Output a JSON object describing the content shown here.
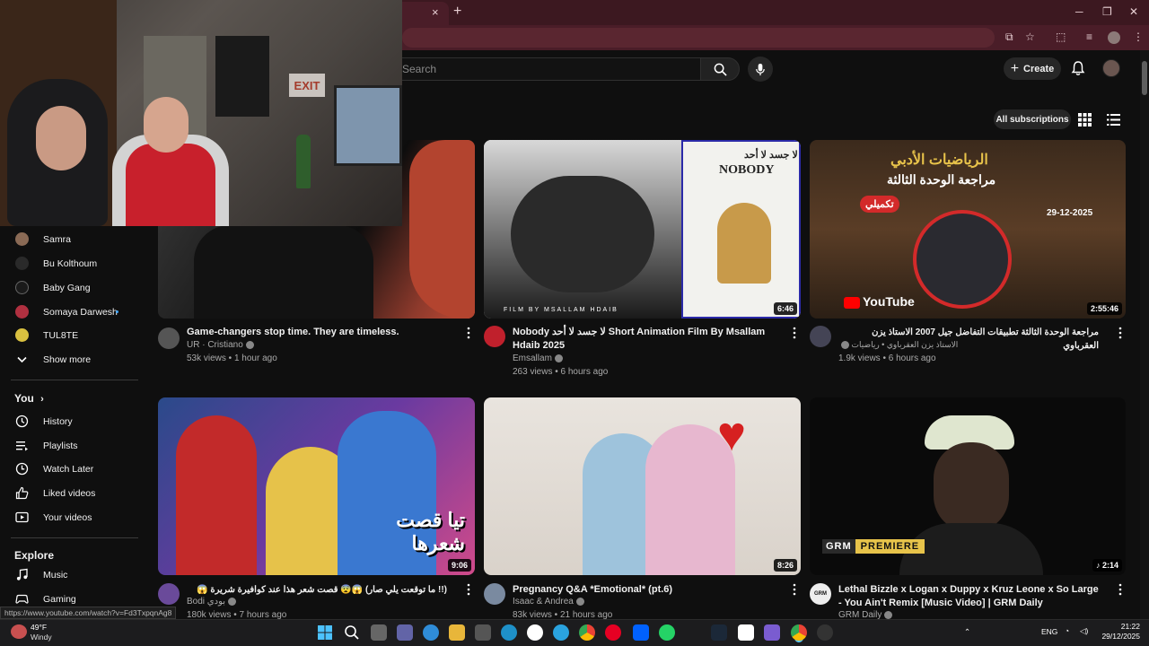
{
  "browser": {
    "tab_close": "×",
    "new_tab": "+",
    "window_min": "─",
    "window_max": "❐",
    "window_close": "✕"
  },
  "header": {
    "search_placeholder": "Search",
    "create_label": "Create"
  },
  "subscriptions": {
    "all_subscriptions_label": "All subscriptions"
  },
  "webcam": {
    "exit_sign": "EXIT"
  },
  "sidebar": {
    "channels": [
      {
        "name": "Samra",
        "color": "#8a6a55"
      },
      {
        "name": "Bu Kolthoum",
        "color": "#2a2a2a"
      },
      {
        "name": "Baby Gang",
        "color": "#1a1a1a"
      },
      {
        "name": "Somaya Darwesh",
        "color": "#b03040",
        "live": true
      },
      {
        "name": "TUL8TE",
        "color": "#d9c040"
      }
    ],
    "show_more": "Show more",
    "you_heading": "You",
    "you_items": [
      {
        "label": "History",
        "icon": "history-icon"
      },
      {
        "label": "Playlists",
        "icon": "playlists-icon"
      },
      {
        "label": "Watch Later",
        "icon": "watch-later-icon"
      },
      {
        "label": "Liked videos",
        "icon": "liked-videos-icon"
      },
      {
        "label": "Your videos",
        "icon": "your-videos-icon"
      }
    ],
    "explore_heading": "Explore",
    "explore_items": [
      {
        "label": "Music",
        "icon": "music-icon"
      },
      {
        "label": "Gaming",
        "icon": "gaming-icon"
      }
    ]
  },
  "videos": [
    {
      "title": "Game-changers stop time. They are timeless.",
      "channel": "UR · Cristiano",
      "meta": "53k views • 1 hour ago",
      "duration": "",
      "avatar_color": "#555"
    },
    {
      "title": "Nobody لا جسد لا أحد Short Animation Film By Msallam Hdaib 2025",
      "channel": "Emsallam",
      "meta": "263 views • 6 hours ago",
      "duration": "6:46",
      "avatar_color": "#c0202c",
      "thumb_text_1": "FILM BY MSALLAM HDAIB",
      "thumb_text_2": "لا جسد لا أحد",
      "thumb_text_3": "NOBODY"
    },
    {
      "title": "مراجعة الوحدة الثالثة تطبيقات التفاضل جيل 2007 الاستاذ يزن العقرباوي",
      "channel": "الاستاذ يزن العقرباوي • رياضيات",
      "meta": "1.9k views • 6 hours ago",
      "duration": "2:55:46",
      "avatar_color": "#445",
      "thumb_text_1": "الرياضيات الأدبي",
      "thumb_text_2": "مراجعة الوحدة الثالثة",
      "thumb_text_3": "29-12-2025",
      "thumb_text_4": "تكميلي",
      "thumb_text_5": "YouTube"
    },
    {
      "title": "(!! ما توقعت يلي صار) 😱😨 قصت شعر هذا عند كوافيرة شريرة 😱",
      "channel": "Bodi بودي",
      "meta": "180k views • 7 hours ago",
      "duration": "9:06",
      "avatar_color": "#6a4a9a",
      "thumb_text_1": "تيا قصت شعرها"
    },
    {
      "title": "Pregnancy Q&A *Emotional* (pt.6)",
      "channel": "Isaac & Andrea",
      "meta": "83k views • 21 hours ago",
      "duration": "8:26",
      "avatar_color": "#7a8aa0"
    },
    {
      "title": "Lethal Bizzle x Logan x Duppy x Kruz Leone x So Large - You Ain't Remix [Music Video] | GRM Daily",
      "channel": "GRM Daily",
      "meta": "",
      "duration": "2:14",
      "avatar_color": "#eee",
      "thumb_text_1": "GRM",
      "thumb_text_2": "PREMIERE",
      "avatar_text": "GRM"
    }
  ],
  "status_url": "https://www.youtube.com/watch?v=Fd3TxpqnAg8",
  "taskbar": {
    "temperature": "49°F",
    "condition": "Windy",
    "language": "ENG",
    "time": "21:22",
    "date": "29/12/2025"
  }
}
